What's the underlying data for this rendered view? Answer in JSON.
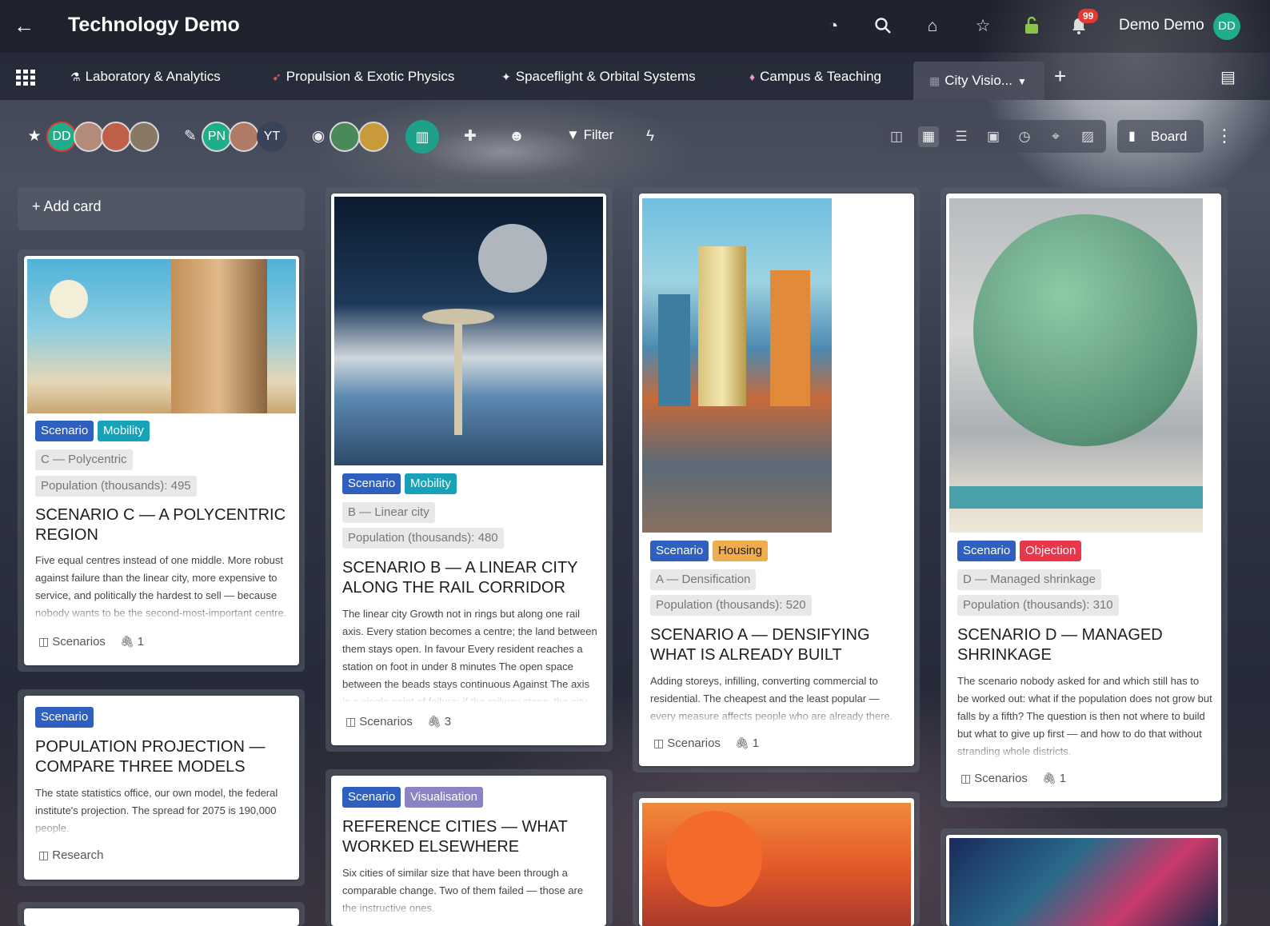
{
  "header": {
    "back_icon": "arrow-left-icon",
    "title": "Technology Demo",
    "notifications": "99",
    "user_name": "Demo Demo",
    "user_initials": "DD"
  },
  "tabs": [
    {
      "label": "Laboratory & Analytics",
      "icon": "flask-icon"
    },
    {
      "label": "Propulsion & Exotic Physics",
      "icon": "rocket-icon"
    },
    {
      "label": "Spaceflight & Orbital Systems",
      "icon": "satellite-icon"
    },
    {
      "label": "Campus & Teaching",
      "icon": "graduation-icon"
    },
    {
      "label": "City Visio...",
      "icon": "city-icon"
    }
  ],
  "toolbar": {
    "admins": [
      "DD"
    ],
    "members": [
      "PN",
      "YT"
    ],
    "filter": "Filter",
    "view_label": "Board"
  },
  "board": {
    "add_card": "+ Add card",
    "cards": [
      {
        "labels": [
          "Scenario",
          "Mobility"
        ],
        "tags": [
          "C — Polycentric",
          "Population (thousands): 495"
        ],
        "title": "SCENARIO C — A POLYCENTRIC REGION",
        "desc": "Five equal centres instead of one middle. More robust against failure than the linear city, more expensive to service, and politically the hardest to sell — because nobody wants to be the second-most-important centre.",
        "list": "Scenarios",
        "attachments": "1"
      },
      {
        "labels": [
          "Scenario"
        ],
        "title": "POPULATION PROJECTION — COMPARE THREE MODELS",
        "desc": "The state statistics office, our own model, the federal institute's projection. The spread for 2075 is 190,000 people.",
        "list": "Research"
      },
      {
        "labels": [
          "Scenario",
          "Mobility"
        ],
        "tags": [
          "B — Linear city",
          "Population (thousands): 480"
        ],
        "title": "SCENARIO B — A LINEAR CITY ALONG THE RAIL CORRIDOR",
        "desc": "The linear city Growth not in rings but along one rail axis. Every station becomes a centre; the land between them stays open. In favour Every resident reaches a station on foot in under 8 minutes The open space between the beads stays continuous Against The axis is a single point of failure: if the railway stops, the city",
        "list": "Scenarios",
        "attachments": "3"
      },
      {
        "labels": [
          "Scenario",
          "Visualisation"
        ],
        "title": "REFERENCE CITIES — WHAT WORKED ELSEWHERE",
        "desc": "Six cities of similar size that have been through a comparable change. Two of them failed — those are the instructive ones."
      },
      {
        "labels": [
          "Scenario",
          "Housing"
        ],
        "tags": [
          "A — Densification",
          "Population (thousands): 520"
        ],
        "title": "SCENARIO A — DENSIFYING WHAT IS ALREADY BUILT",
        "desc": "Adding storeys, infilling, converting commercial to residential. The cheapest and the least popular — every measure affects people who are already there.",
        "list": "Scenarios",
        "attachments": "1"
      },
      {
        "labels": [
          "Scenario",
          "Objection"
        ],
        "tags": [
          "D — Managed shrinkage",
          "Population (thousands): 310"
        ],
        "title": "SCENARIO D — MANAGED SHRINKAGE",
        "desc": "The scenario nobody asked for and which still has to be worked out: what if the population does not grow but falls by a fifth? The question is then not where to build but what to give up first — and how to do that without stranding whole districts.",
        "list": "Scenarios",
        "attachments": "1"
      }
    ]
  }
}
